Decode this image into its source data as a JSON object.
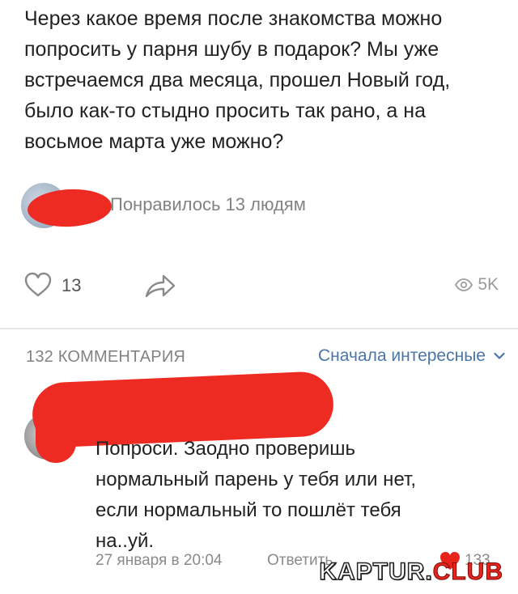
{
  "post": {
    "text_lines": [
      "Через какое время после знакомства можно",
      "попросить у парня шубу в подарок? Мы уже",
      "встречаемся два месяца, прошел Новый год,",
      "было как-то стыдно просить так рано, а на",
      "восьмое марта уже можно?"
    ],
    "liked_by_text": "Понравилось 13 людям",
    "like_count": "13",
    "views": "5K"
  },
  "comments": {
    "header": "132 КОММЕНТАРИЯ",
    "sort_label": "Сначала интересные",
    "items": [
      {
        "text_lines": [
          "Попроси. Заодно проверишь",
          "нормальный парень у тебя или нет,",
          "если нормальный то пошлёт тебя",
          "на..уй."
        ],
        "date": "27 января в 20:04",
        "reply_label": "Ответить",
        "likes": "133"
      }
    ]
  },
  "watermark": {
    "main": "KAPTUR.",
    "accent": "CLUB"
  },
  "colors": {
    "link": "#4a76a8",
    "muted": "#828282",
    "redaction": "#ee2b22"
  },
  "icons": [
    "heart-icon",
    "share-icon",
    "eye-icon",
    "chevron-down-icon"
  ]
}
